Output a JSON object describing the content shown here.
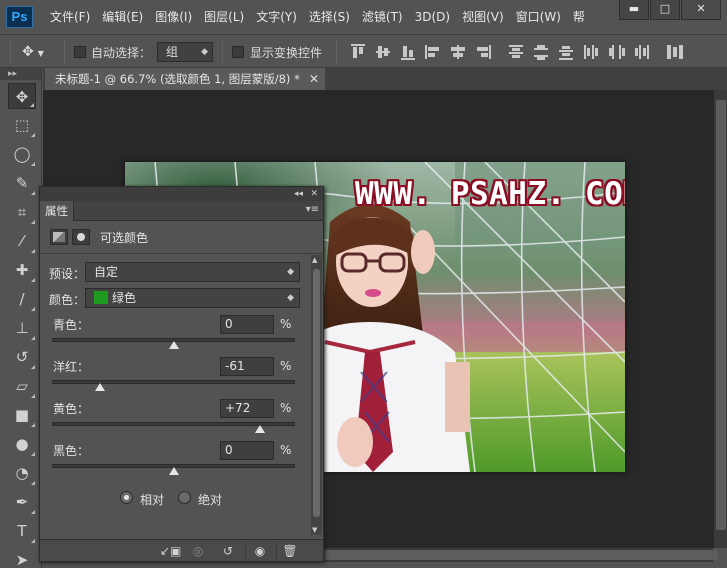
{
  "app": {
    "logo": "Ps",
    "menu": [
      "文件(F)",
      "编辑(E)",
      "图像(I)",
      "图层(L)",
      "文字(Y)",
      "选择(S)",
      "滤镜(T)",
      "3D(D)",
      "视图(V)",
      "窗口(W)",
      "帮"
    ],
    "window_controls": {
      "minimize": "▬",
      "maximize": "□",
      "close": "✕"
    }
  },
  "options_bar": {
    "auto_select_label": "自动选择：",
    "auto_select_value": "组",
    "show_transform_label": "显示变换控件"
  },
  "tools": [
    {
      "name": "move-tool",
      "glyph": "✥"
    },
    {
      "name": "marquee-tool",
      "glyph": "⬚"
    },
    {
      "name": "lasso-tool",
      "glyph": "◯"
    },
    {
      "name": "quick-select-tool",
      "glyph": "✎"
    },
    {
      "name": "crop-tool",
      "glyph": "⌗"
    },
    {
      "name": "eyedropper-tool",
      "glyph": "⁄"
    },
    {
      "name": "healing-brush-tool",
      "glyph": "✚"
    },
    {
      "name": "brush-tool",
      "glyph": "/"
    },
    {
      "name": "stamp-tool",
      "glyph": "⊥"
    },
    {
      "name": "history-brush-tool",
      "glyph": "↺"
    },
    {
      "name": "eraser-tool",
      "glyph": "▱"
    },
    {
      "name": "gradient-tool",
      "glyph": "■"
    },
    {
      "name": "blur-tool",
      "glyph": "●"
    },
    {
      "name": "dodge-tool",
      "glyph": "◔"
    },
    {
      "name": "pen-tool",
      "glyph": "✒"
    },
    {
      "name": "type-tool",
      "glyph": "T"
    },
    {
      "name": "path-select-tool",
      "glyph": "➤"
    },
    {
      "name": "shape-tool",
      "glyph": "▭"
    }
  ],
  "document": {
    "tab_title": "未标题-1 @ 66.7% (选取颜色 1, 图层蒙版/8) *",
    "close": "✕",
    "watermark": "WWW. PSAHZ. COM"
  },
  "properties": {
    "tab": "属性",
    "adjustment_title": "可选颜色",
    "preset_label": "预设：",
    "preset_value": "自定",
    "colors_label": "颜色：",
    "colors_value": "绿色",
    "colors_swatch": "#1e9b1e",
    "sliders": [
      {
        "label": "青色：",
        "value": "0",
        "pct": "%",
        "fraction": 0.5
      },
      {
        "label": "洋红：",
        "value": "-61",
        "pct": "%",
        "fraction": 0.195
      },
      {
        "label": "黄色：",
        "value": "+72",
        "pct": "%",
        "fraction": 0.86
      },
      {
        "label": "黑色：",
        "value": "0",
        "pct": "%",
        "fraction": 0.5
      }
    ],
    "method_relative": "相对",
    "method_absolute": "绝对",
    "method_selected": "relative"
  }
}
